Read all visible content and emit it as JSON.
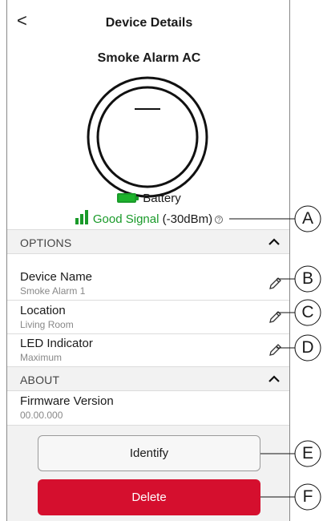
{
  "header": {
    "title": "Device Details",
    "back_label": "<"
  },
  "device": {
    "name": "Smoke Alarm AC"
  },
  "status": {
    "battery_label": "Battery",
    "signal_label": "Good Signal",
    "signal_value": "(-30dBm)",
    "help_glyph": "?"
  },
  "options": {
    "header": "OPTIONS",
    "items": [
      {
        "name": "Device Name",
        "value": "Smoke Alarm 1"
      },
      {
        "name": "Location",
        "value": "Living Room"
      },
      {
        "name": "LED Indicator",
        "value": "Maximum"
      }
    ]
  },
  "about": {
    "header": "ABOUT",
    "items": [
      {
        "name": "Firmware Version",
        "value": "00.00.000"
      }
    ]
  },
  "actions": {
    "identify_label": "Identify",
    "delete_label": "Delete"
  },
  "callouts": [
    "A",
    "B",
    "C",
    "D",
    "E",
    "F"
  ],
  "colors": {
    "accent_green": "#1a9a2a",
    "delete_red": "#d50f2e",
    "section_bg": "#f2f2f2"
  },
  "icons": {
    "back": "chevron-left-icon",
    "edit": "pencil-icon",
    "collapse": "chevron-up-icon",
    "battery": "battery-icon",
    "signal": "signal-bars-icon",
    "help": "help-icon"
  }
}
